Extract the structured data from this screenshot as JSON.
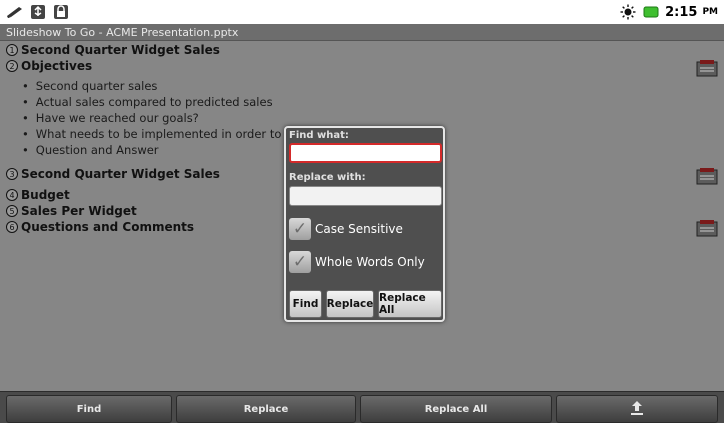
{
  "status_bar": {
    "time": "2:15",
    "ampm": "PM",
    "left_icons": [
      "pen-icon",
      "usb-icon",
      "lock-icon"
    ],
    "right_icons": [
      "sun-icon",
      "battery-icon"
    ]
  },
  "title_bar": {
    "text": "Slideshow To Go - ACME Presentation.pptx"
  },
  "outline": {
    "items": [
      {
        "number": "1",
        "title": "Second Quarter Widget Sales"
      },
      {
        "number": "2",
        "title": "Objectives"
      },
      {
        "number": "3",
        "title": "Second Quarter Widget Sales"
      },
      {
        "number": "4",
        "title": "Budget"
      },
      {
        "number": "5",
        "title": "Sales Per Widget"
      },
      {
        "number": "6",
        "title": "Questions and Comments"
      }
    ],
    "bullets": [
      "Second quarter sales",
      "Actual sales compared to predicted sales",
      "Have we reached our goals?",
      "What needs to be implemented in order to increase",
      "Question and Answer"
    ]
  },
  "dialog": {
    "find_label": "Find what:",
    "find_value": "",
    "replace_label": "Replace with:",
    "replace_value": "",
    "case_sensitive_label": "Case Sensitive",
    "case_sensitive_checked": true,
    "whole_words_label": "Whole Words Only",
    "whole_words_checked": true,
    "buttons": {
      "find": "Find",
      "replace": "Replace",
      "replace_all": "Replace All"
    }
  },
  "bottom_bar": {
    "find": "Find",
    "replace": "Replace",
    "replace_all": "Replace All",
    "upload_icon": "upload-icon"
  },
  "colors": {
    "focus_border": "#d42a2a",
    "dialog_bg": "#4f4f4f"
  }
}
